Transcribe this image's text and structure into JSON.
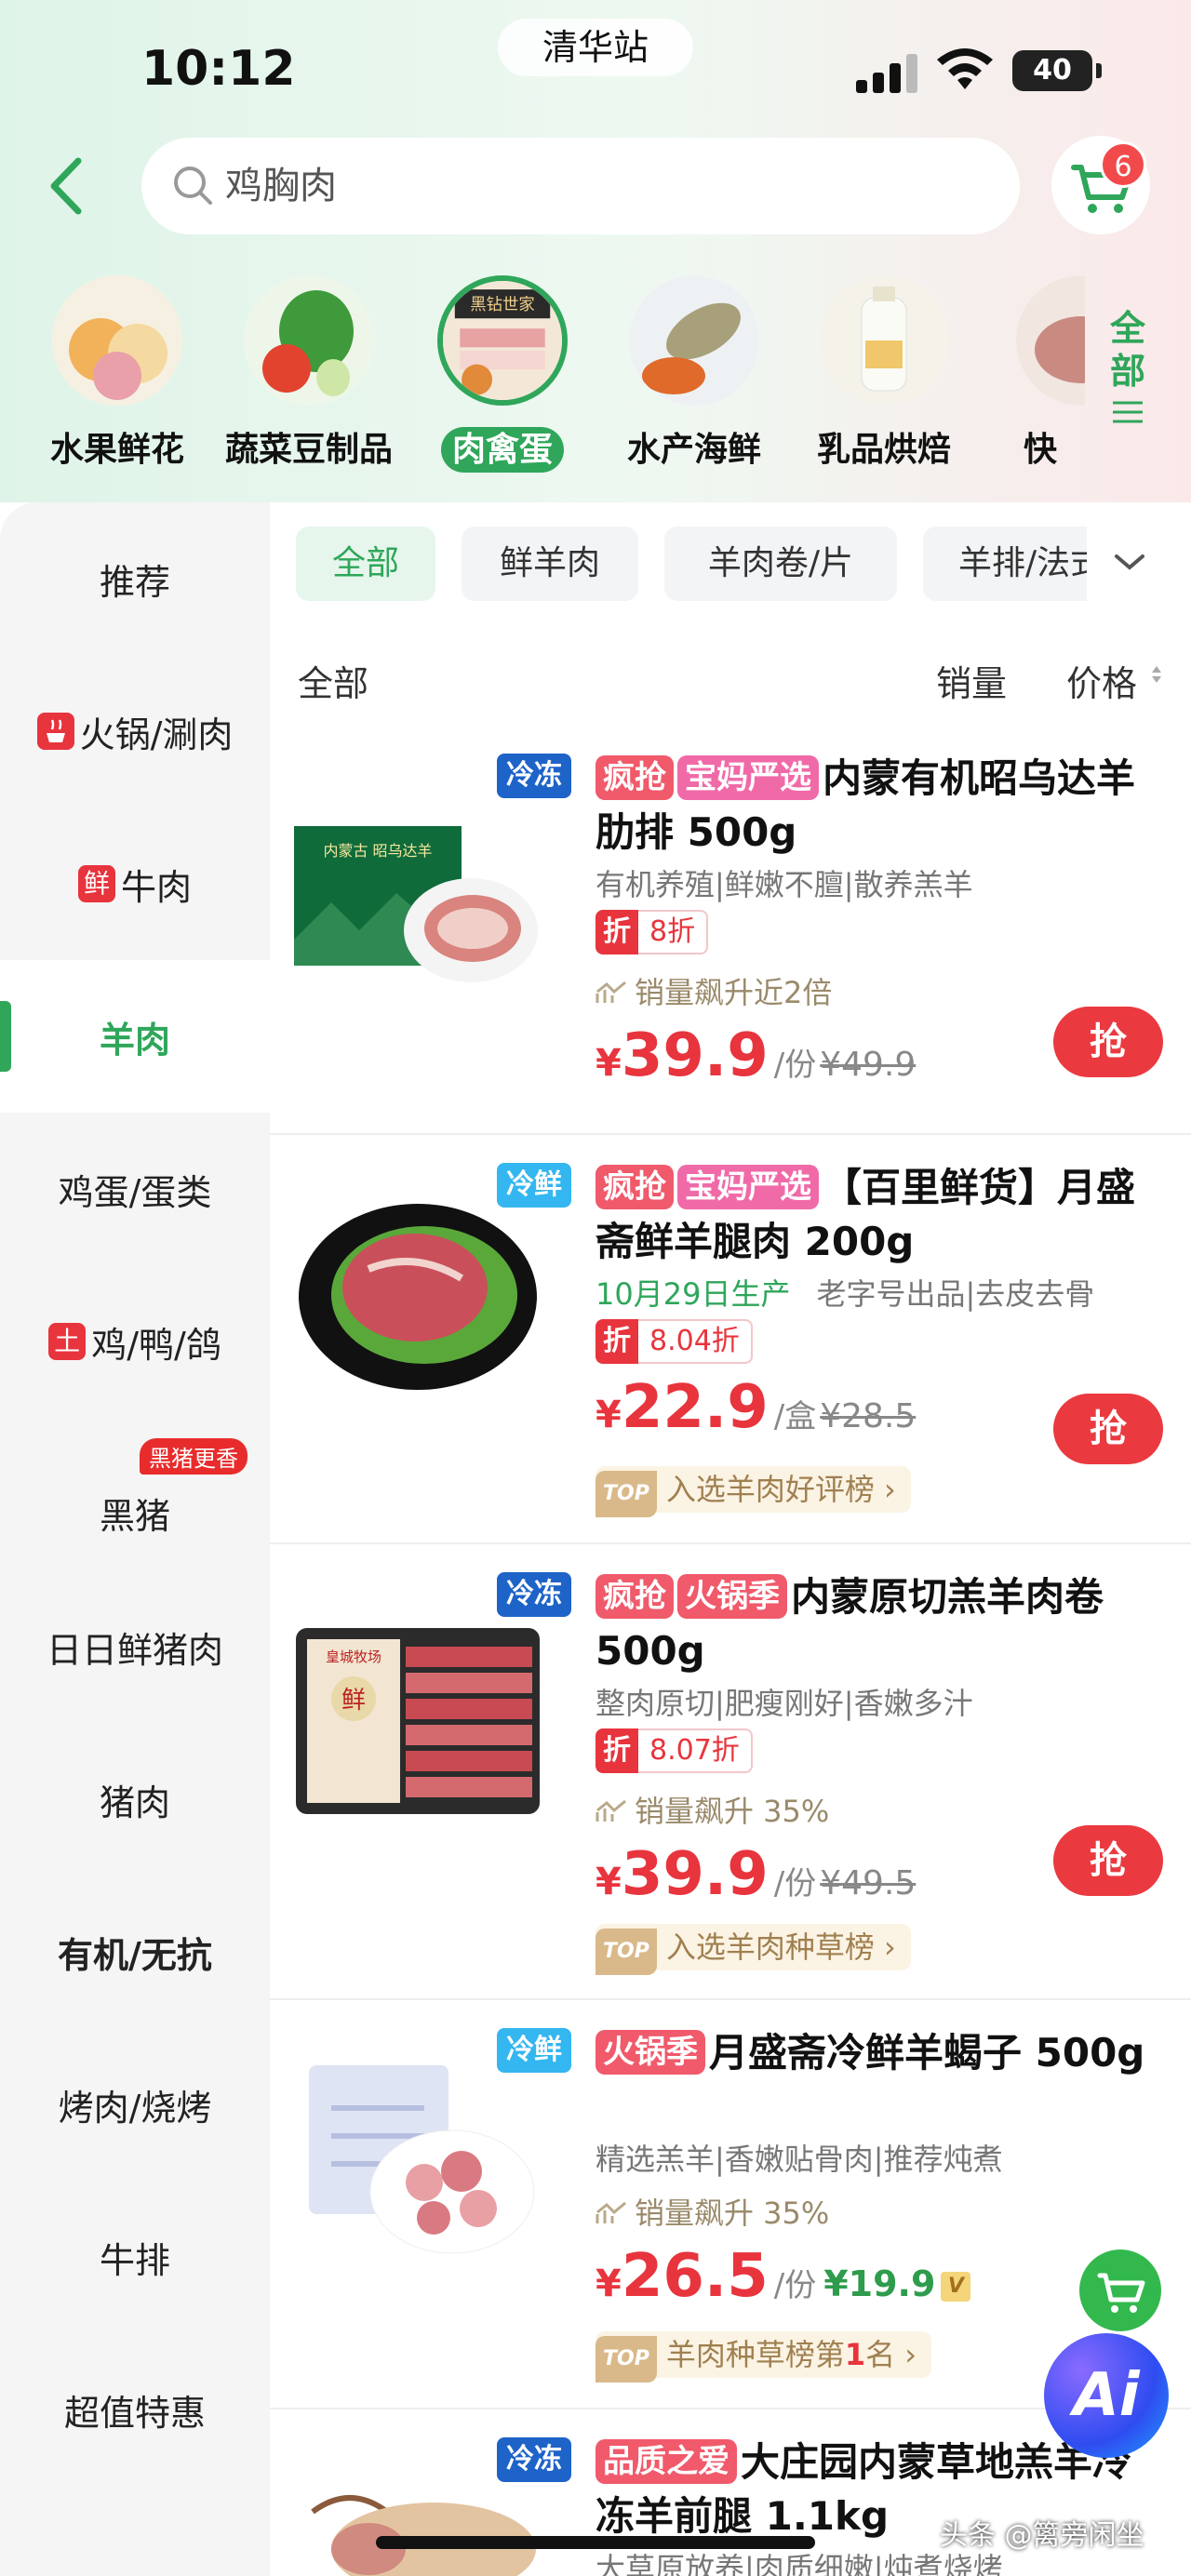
{
  "status_bar": {
    "time": "10:12",
    "location": "清华站",
    "battery": "40"
  },
  "search": {
    "query": "鸡胸肉"
  },
  "cart": {
    "badge": "6"
  },
  "categories": [
    {
      "label": "水果鲜花"
    },
    {
      "label": "蔬菜豆制品"
    },
    {
      "label": "肉禽蛋",
      "img_text": "黑钻世家",
      "active": true
    },
    {
      "label": "水产海鲜"
    },
    {
      "label": "乳品烘焙"
    },
    {
      "label": "快"
    }
  ],
  "all_categories": {
    "label_top": "全",
    "label_bottom": "部"
  },
  "sidebar": {
    "items": [
      {
        "label": "推荐"
      },
      {
        "label": "火锅/涮肉"
      },
      {
        "label": "牛肉",
        "tag": "鲜"
      },
      {
        "label": "羊肉",
        "active": true
      },
      {
        "label": "鸡蛋/蛋类"
      },
      {
        "label": "鸡/鸭/鸽",
        "tag": "土"
      },
      {
        "label": "黑猪",
        "badge": "黑猪更香"
      },
      {
        "label": "日日鲜猪肉"
      },
      {
        "label": "猪肉"
      },
      {
        "label": "有机/无抗"
      },
      {
        "label": "烤肉/烧烤"
      },
      {
        "label": "牛排"
      },
      {
        "label": "超值特惠"
      }
    ]
  },
  "filters": {
    "chips": [
      "全部",
      "鲜羊肉",
      "羊肉卷/片",
      "羊排/法式"
    ]
  },
  "sort": {
    "all": "全部",
    "sales": "销量",
    "price": "价格"
  },
  "products": [
    {
      "temp": "冷冻",
      "tags": [
        "疯抢",
        "宝妈严选"
      ],
      "title": "内蒙有机昭乌达羊肋排 500g",
      "img_text": "内蒙古 昭乌达羊",
      "desc": "有机养殖|鲜嫩不膻|散养羔羊",
      "discount_label": "折",
      "discount": "8折",
      "trend": "销量飙升近2倍",
      "currency": "¥",
      "price": "39.9",
      "unit": "/份",
      "old_price": "¥49.9",
      "buy": "抢"
    },
    {
      "temp": "冷鲜",
      "tags": [
        "疯抢",
        "宝妈严选"
      ],
      "title": "【百里鲜货】月盛斋鲜羊腿肉 200g",
      "desc_green": "10月29日生产",
      "desc": "老字号出品|去皮去骨",
      "discount_label": "折",
      "discount": "8.04折",
      "currency": "¥",
      "price": "22.9",
      "unit": "/盒",
      "old_price": "¥28.5",
      "rank_tag": "TOP",
      "rank": "入选羊肉好评榜 ›",
      "buy": "抢"
    },
    {
      "temp": "冷冻",
      "tags": [
        "疯抢",
        "火锅季"
      ],
      "title": "内蒙原切羔羊肉卷 500g",
      "img_text": "皇城牧场",
      "img_badge": "鲜",
      "desc": "整肉原切|肥瘦刚好|香嫩多汁",
      "discount_label": "折",
      "discount": "8.07折",
      "trend": "销量飙升 35%",
      "currency": "¥",
      "price": "39.9",
      "unit": "/份",
      "old_price": "¥49.5",
      "rank_tag": "TOP",
      "rank": "入选羊肉种草榜 ›",
      "buy": "抢"
    },
    {
      "temp": "冷鲜",
      "tags": [
        "火锅季"
      ],
      "title": "月盛斋冷鲜羊蝎子 500g",
      "desc": "精选羔羊|香嫩贴骨肉|推荐炖煮",
      "trend": "销量飙升 35%",
      "currency": "¥",
      "price": "26.5",
      "unit": "/份",
      "member_price": "¥19.9",
      "member_badge": "V",
      "rank_tag": "TOP",
      "rank_pre": "羊肉种草榜第",
      "rank_num": "1",
      "rank_post": "名 ›"
    },
    {
      "temp": "冷冻",
      "tags": [
        "品质之爱"
      ],
      "title": "大庄园内蒙草地羔羊冷冻羊前腿 1.1kg",
      "desc": "大草原放养|肉质细嫩|炖煮烧烤"
    }
  ],
  "float": {
    "ai_label": "Ai"
  },
  "watermark": "头条 @篱旁闲坐",
  "colors": {
    "accent_green": "#2fa65a",
    "price_red": "#e8343d",
    "frozen_blue": "#1e63c8",
    "fresh_blue": "#34b6f0"
  }
}
